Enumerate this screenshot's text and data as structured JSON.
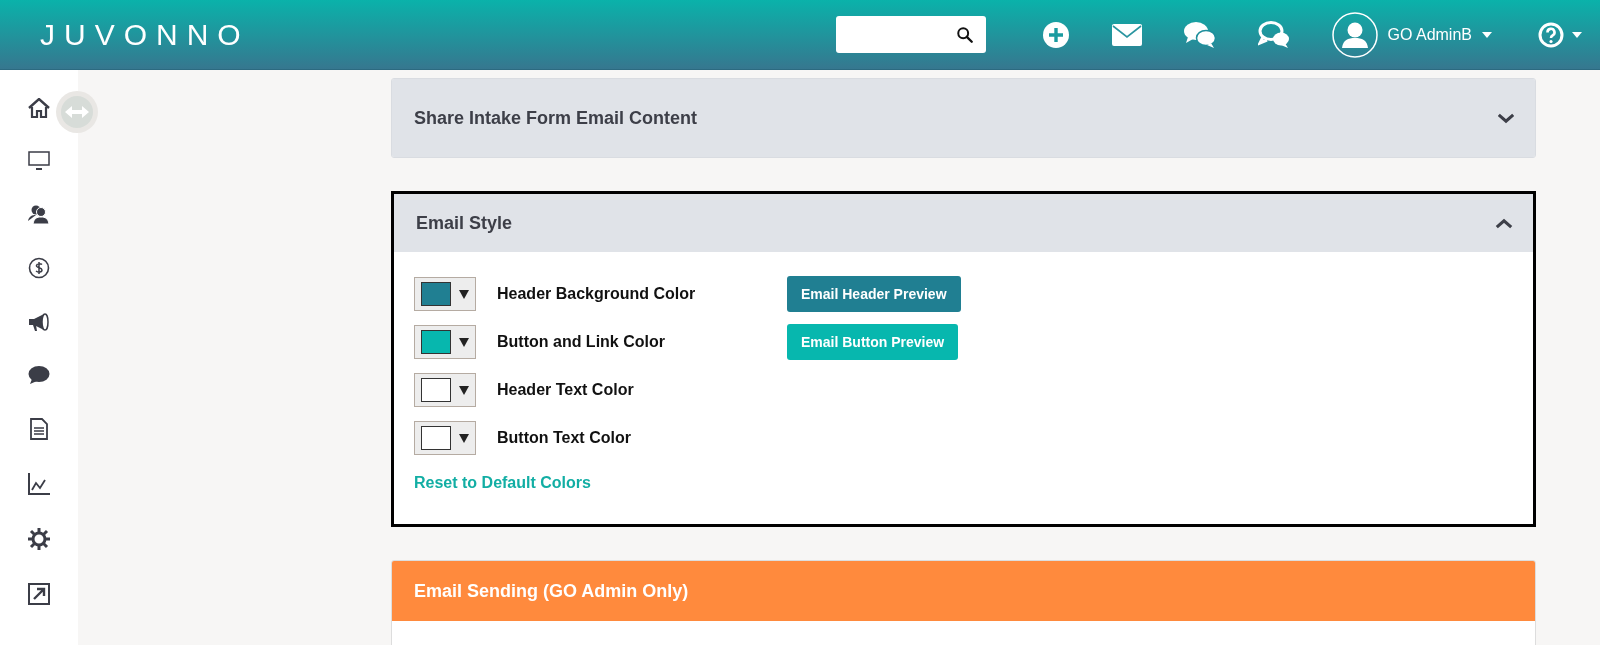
{
  "header": {
    "logo": "JUVONNO",
    "user": {
      "name": "GO AdminB"
    }
  },
  "panels": [
    {
      "title": "Share Intake Form Email Content",
      "kind": "default",
      "expanded": false,
      "focused": false
    },
    {
      "title": "Email Style",
      "kind": "default",
      "expanded": true,
      "focused": true,
      "colors": [
        {
          "label": "Header Background Color",
          "color": "#207f92",
          "preview": "Email Header Preview"
        },
        {
          "label": "Button and Link Color",
          "color": "#07b7ae",
          "preview": "Email Button Preview"
        },
        {
          "label": "Header Text Color",
          "color": "#ffffff"
        },
        {
          "label": "Button Text Color",
          "color": "#ffffff"
        }
      ],
      "reset_link": "Reset to Default Colors"
    },
    {
      "title": "Email Sending (GO Admin Only)",
      "kind": "warning",
      "expanded": true,
      "focused": false
    }
  ]
}
